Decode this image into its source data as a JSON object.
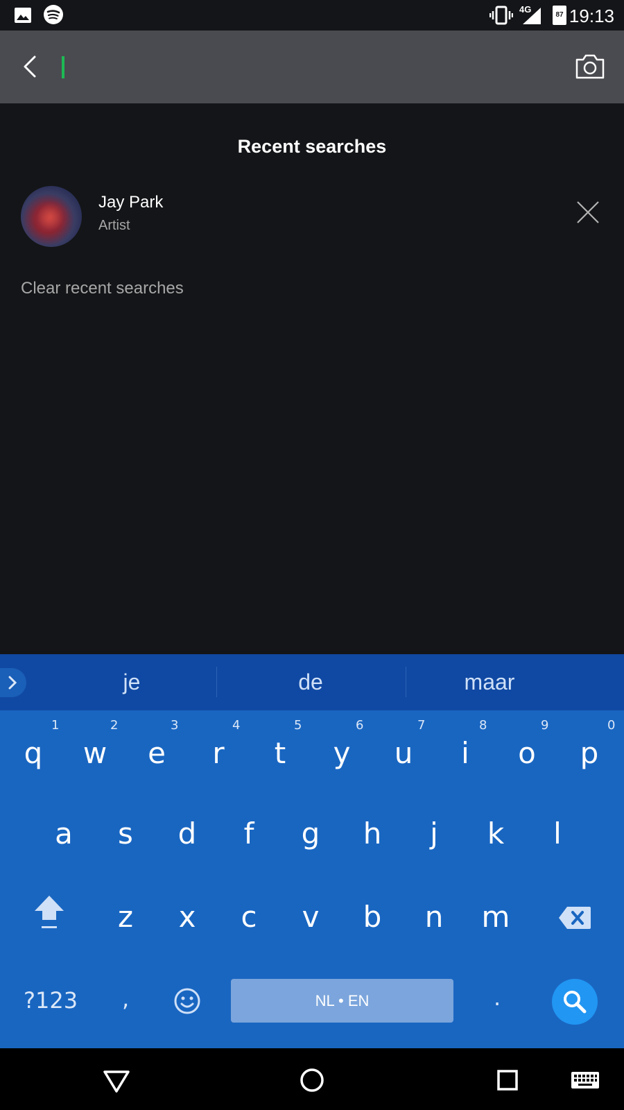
{
  "status_bar": {
    "time": "19:13",
    "network": "4G",
    "battery": "87",
    "left_icons": [
      "image-icon",
      "spotify-icon"
    ],
    "right_icons": [
      "vibrate-icon",
      "signal-icon",
      "battery-icon"
    ]
  },
  "search": {
    "query": "",
    "placeholder": "",
    "back_icon": "back-arrow-icon",
    "camera_icon": "camera-icon"
  },
  "recent": {
    "title": "Recent searches",
    "items": [
      {
        "name": "Jay Park",
        "type": "Artist"
      }
    ],
    "clear_label": "Clear recent searches"
  },
  "keyboard": {
    "suggestions": [
      "je",
      "de",
      "maar"
    ],
    "row1": [
      "q",
      "w",
      "e",
      "r",
      "t",
      "y",
      "u",
      "i",
      "o",
      "p"
    ],
    "row1_hints": [
      "1",
      "2",
      "3",
      "4",
      "5",
      "6",
      "7",
      "8",
      "9",
      "0"
    ],
    "row2": [
      "a",
      "s",
      "d",
      "f",
      "g",
      "h",
      "j",
      "k",
      "l"
    ],
    "row3": [
      "z",
      "x",
      "c",
      "v",
      "b",
      "n",
      "m"
    ],
    "symbols_label": "?123",
    "comma": ",",
    "period": ".",
    "space_label": "NL • EN",
    "accent_color": "#1966c1",
    "action_color": "#2196f3"
  },
  "nav_bar": {
    "buttons": [
      "back-triangle-icon",
      "home-circle-icon",
      "recents-square-icon",
      "keyboard-icon"
    ]
  },
  "colors": {
    "background": "#141518",
    "header": "#4a4b50",
    "caret": "#1db954",
    "secondary_text": "#a7a7a7"
  }
}
